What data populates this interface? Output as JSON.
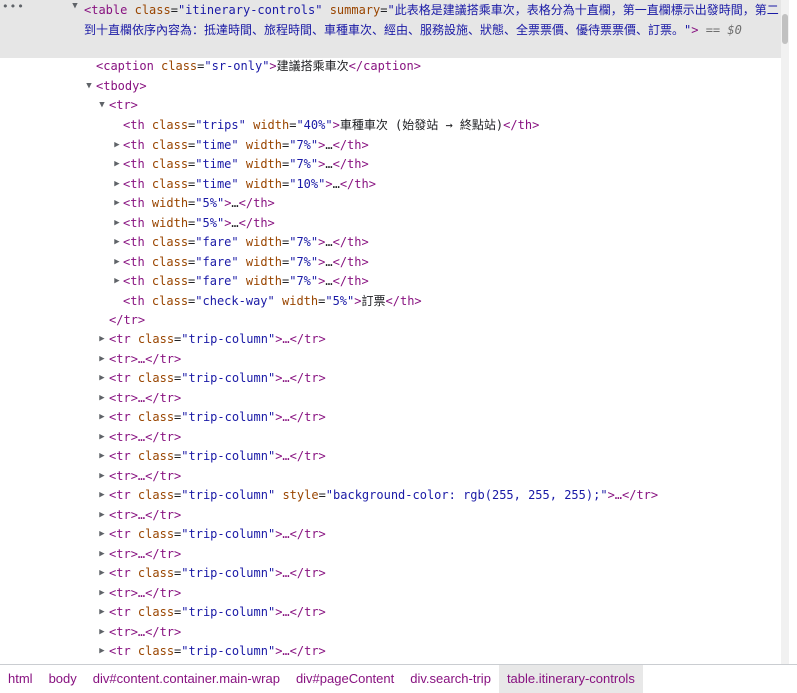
{
  "tree": {
    "selected": {
      "open": "<table",
      "class_attr": "class",
      "class_val": "\"itinerary-controls\"",
      "summary_attr": "summary",
      "summary_val": "\"此表格是建議搭乘車次，表格分為十直欄，第一直欄標示出發時間，第二到十直欄依序內容為：抵達時間、旅程時間、車種車次、經由、服務設施、狀態、全票票價、優待票票價、訂票。\"",
      "close": ">",
      "marker": "== $0",
      "more_icon": "•••"
    },
    "caption": {
      "open": "<caption",
      "attr": "class",
      "val": "\"sr-only\"",
      "gt": ">",
      "text": "建議搭乘車次",
      "close": "</caption>"
    },
    "tbody_open": "<tbody>",
    "tr_open": "<tr>",
    "tr_close": "</tr>",
    "th_rows": [
      {
        "expand": false,
        "attrs": [
          {
            "n": "class",
            "v": "\"trips\""
          },
          {
            "n": "width",
            "v": "\"40%\""
          }
        ],
        "content": "車種車次 (始發站 → 終點站)",
        "close": "</th>"
      },
      {
        "expand": true,
        "attrs": [
          {
            "n": "class",
            "v": "\"time\""
          },
          {
            "n": "width",
            "v": "\"7%\""
          }
        ],
        "content": "…",
        "close": "</th>"
      },
      {
        "expand": true,
        "attrs": [
          {
            "n": "class",
            "v": "\"time\""
          },
          {
            "n": "width",
            "v": "\"7%\""
          }
        ],
        "content": "…",
        "close": "</th>"
      },
      {
        "expand": true,
        "attrs": [
          {
            "n": "class",
            "v": "\"time\""
          },
          {
            "n": "width",
            "v": "\"10%\""
          }
        ],
        "content": "…",
        "close": "</th>"
      },
      {
        "expand": true,
        "attrs": [
          {
            "n": "width",
            "v": "\"5%\""
          }
        ],
        "content": "…",
        "close": "</th>"
      },
      {
        "expand": true,
        "attrs": [
          {
            "n": "width",
            "v": "\"5%\""
          }
        ],
        "content": "…",
        "close": "</th>"
      },
      {
        "expand": true,
        "attrs": [
          {
            "n": "class",
            "v": "\"fare\""
          },
          {
            "n": "width",
            "v": "\"7%\""
          }
        ],
        "content": "…",
        "close": "</th>"
      },
      {
        "expand": true,
        "attrs": [
          {
            "n": "class",
            "v": "\"fare\""
          },
          {
            "n": "width",
            "v": "\"7%\""
          }
        ],
        "content": "…",
        "close": "</th>"
      },
      {
        "expand": true,
        "attrs": [
          {
            "n": "class",
            "v": "\"fare\""
          },
          {
            "n": "width",
            "v": "\"7%\""
          }
        ],
        "content": "…",
        "close": "</th>"
      },
      {
        "expand": false,
        "attrs": [
          {
            "n": "class",
            "v": "\"check-way\""
          },
          {
            "n": "width",
            "v": "\"5%\""
          }
        ],
        "content": "訂票",
        "close": "</th>"
      }
    ],
    "body_rows": [
      {
        "attrs": [
          {
            "n": "class",
            "v": "\"trip-column\""
          }
        ]
      },
      {
        "attrs": []
      },
      {
        "attrs": [
          {
            "n": "class",
            "v": "\"trip-column\""
          }
        ]
      },
      {
        "attrs": []
      },
      {
        "attrs": [
          {
            "n": "class",
            "v": "\"trip-column\""
          }
        ]
      },
      {
        "attrs": []
      },
      {
        "attrs": [
          {
            "n": "class",
            "v": "\"trip-column\""
          }
        ]
      },
      {
        "attrs": []
      },
      {
        "attrs": [
          {
            "n": "class",
            "v": "\"trip-column\""
          },
          {
            "n": "style",
            "v": "\"background-color: rgb(255, 255, 255);\""
          }
        ]
      },
      {
        "attrs": []
      },
      {
        "attrs": [
          {
            "n": "class",
            "v": "\"trip-column\""
          }
        ]
      },
      {
        "attrs": []
      },
      {
        "attrs": [
          {
            "n": "class",
            "v": "\"trip-column\""
          }
        ]
      },
      {
        "attrs": []
      },
      {
        "attrs": [
          {
            "n": "class",
            "v": "\"trip-column\""
          }
        ]
      },
      {
        "attrs": []
      },
      {
        "attrs": [
          {
            "n": "class",
            "v": "\"trip-column\""
          }
        ]
      }
    ],
    "row_tag_open": "<tr",
    "row_tail": ">…</tr>"
  },
  "breadcrumbs": [
    "html",
    "body",
    "div#content.container.main-wrap",
    "div#pageContent",
    "div.search-trip",
    "table.itinerary-controls"
  ],
  "icons": {
    "collapse": "▼",
    "expand": "▶"
  },
  "colors": {
    "tag": "#881280",
    "attr_name": "#994500",
    "attr_value": "#1a1aa6",
    "selection": "#e6e6e6"
  }
}
